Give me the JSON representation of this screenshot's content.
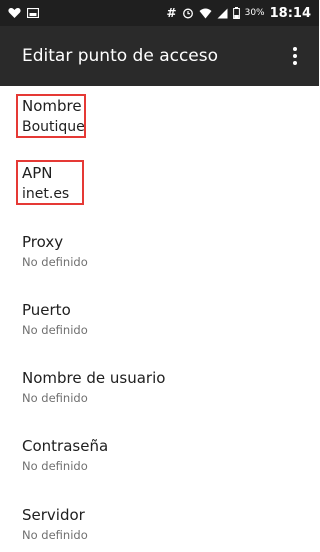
{
  "status_bar": {
    "battery_percent": "30%",
    "time": "18:14",
    "hash_symbol": "#"
  },
  "app_bar": {
    "title": "Editar punto de acceso",
    "menu_icon": "more-vert-icon"
  },
  "preferences": [
    {
      "title": "Nombre",
      "value": "Boutique"
    },
    {
      "title": "APN",
      "value": "inet.es"
    },
    {
      "title": "Proxy",
      "value": "No definido"
    },
    {
      "title": "Puerto",
      "value": "No definido"
    },
    {
      "title": "Nombre de usuario",
      "value": "No definido"
    },
    {
      "title": "Contraseña",
      "value": "No definido"
    },
    {
      "title": "Servidor",
      "value": "No definido"
    }
  ],
  "colors": {
    "highlight": "#e53935",
    "app_bar": "#2a2a2a",
    "status_bar": "#1f1f1f"
  }
}
